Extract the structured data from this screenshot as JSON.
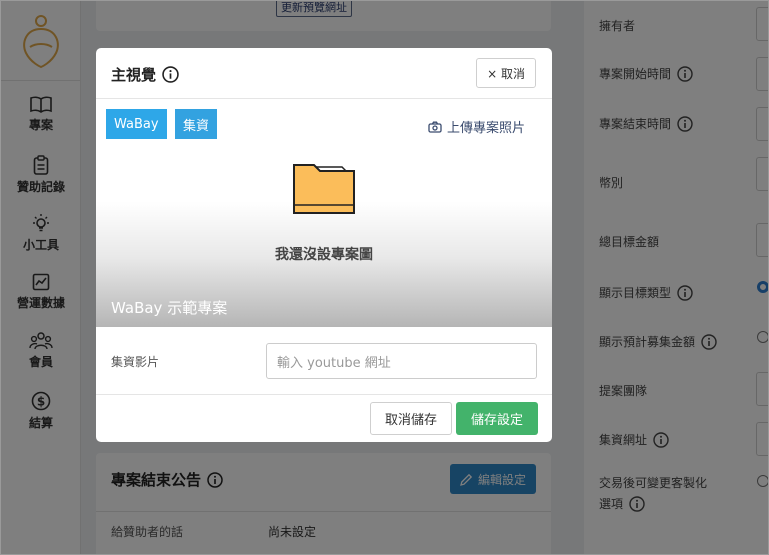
{
  "sidebar": {
    "items": [
      {
        "label": "專案",
        "icon": "book-icon"
      },
      {
        "label": "贊助記錄",
        "icon": "clipboard-icon"
      },
      {
        "label": "小工具",
        "icon": "lightbulb-icon"
      },
      {
        "label": "營運數據",
        "icon": "chart-icon"
      },
      {
        "label": "會員",
        "icon": "users-icon"
      },
      {
        "label": "結算",
        "icon": "dollar-icon"
      }
    ]
  },
  "main": {
    "update_preview_url_button": "更新預覽網址",
    "closing_notice": {
      "title": "專案結束公告",
      "edit_button": "編輯設定",
      "row_label": "給贊助者的話",
      "row_value": "尚未設定"
    }
  },
  "right_panel": {
    "fields": [
      {
        "label": "擁有者"
      },
      {
        "label": "專案開始時間"
      },
      {
        "label": "專案結束時間"
      },
      {
        "label": "幣別"
      },
      {
        "label": "總目標金額"
      },
      {
        "label": "顯示目標類型"
      },
      {
        "label": "顯示預計募集金額"
      },
      {
        "label": "提案團隊"
      },
      {
        "label": "集資網址"
      },
      {
        "label": "交易後可變更客製化"
      },
      {
        "label": "選項"
      }
    ]
  },
  "modal": {
    "title": "主視覺",
    "close_button": "× 取消",
    "tags": [
      "WaBay",
      "集資"
    ],
    "upload_button": "上傳專案照片",
    "empty_text": "我還沒設專案圖",
    "project_name": "WaBay 示範專案",
    "video_label": "集資影片",
    "video_placeholder": "輸入 youtube 網址",
    "cancel_save_button": "取消儲存",
    "save_button": "儲存設定"
  },
  "colors": {
    "tag_blue": "#2ea7e8",
    "save_green": "#43b36b",
    "edit_blue": "#2f88c9",
    "logo_gold": "#e0a94a",
    "folder_yellow": "#fbbd5a"
  }
}
